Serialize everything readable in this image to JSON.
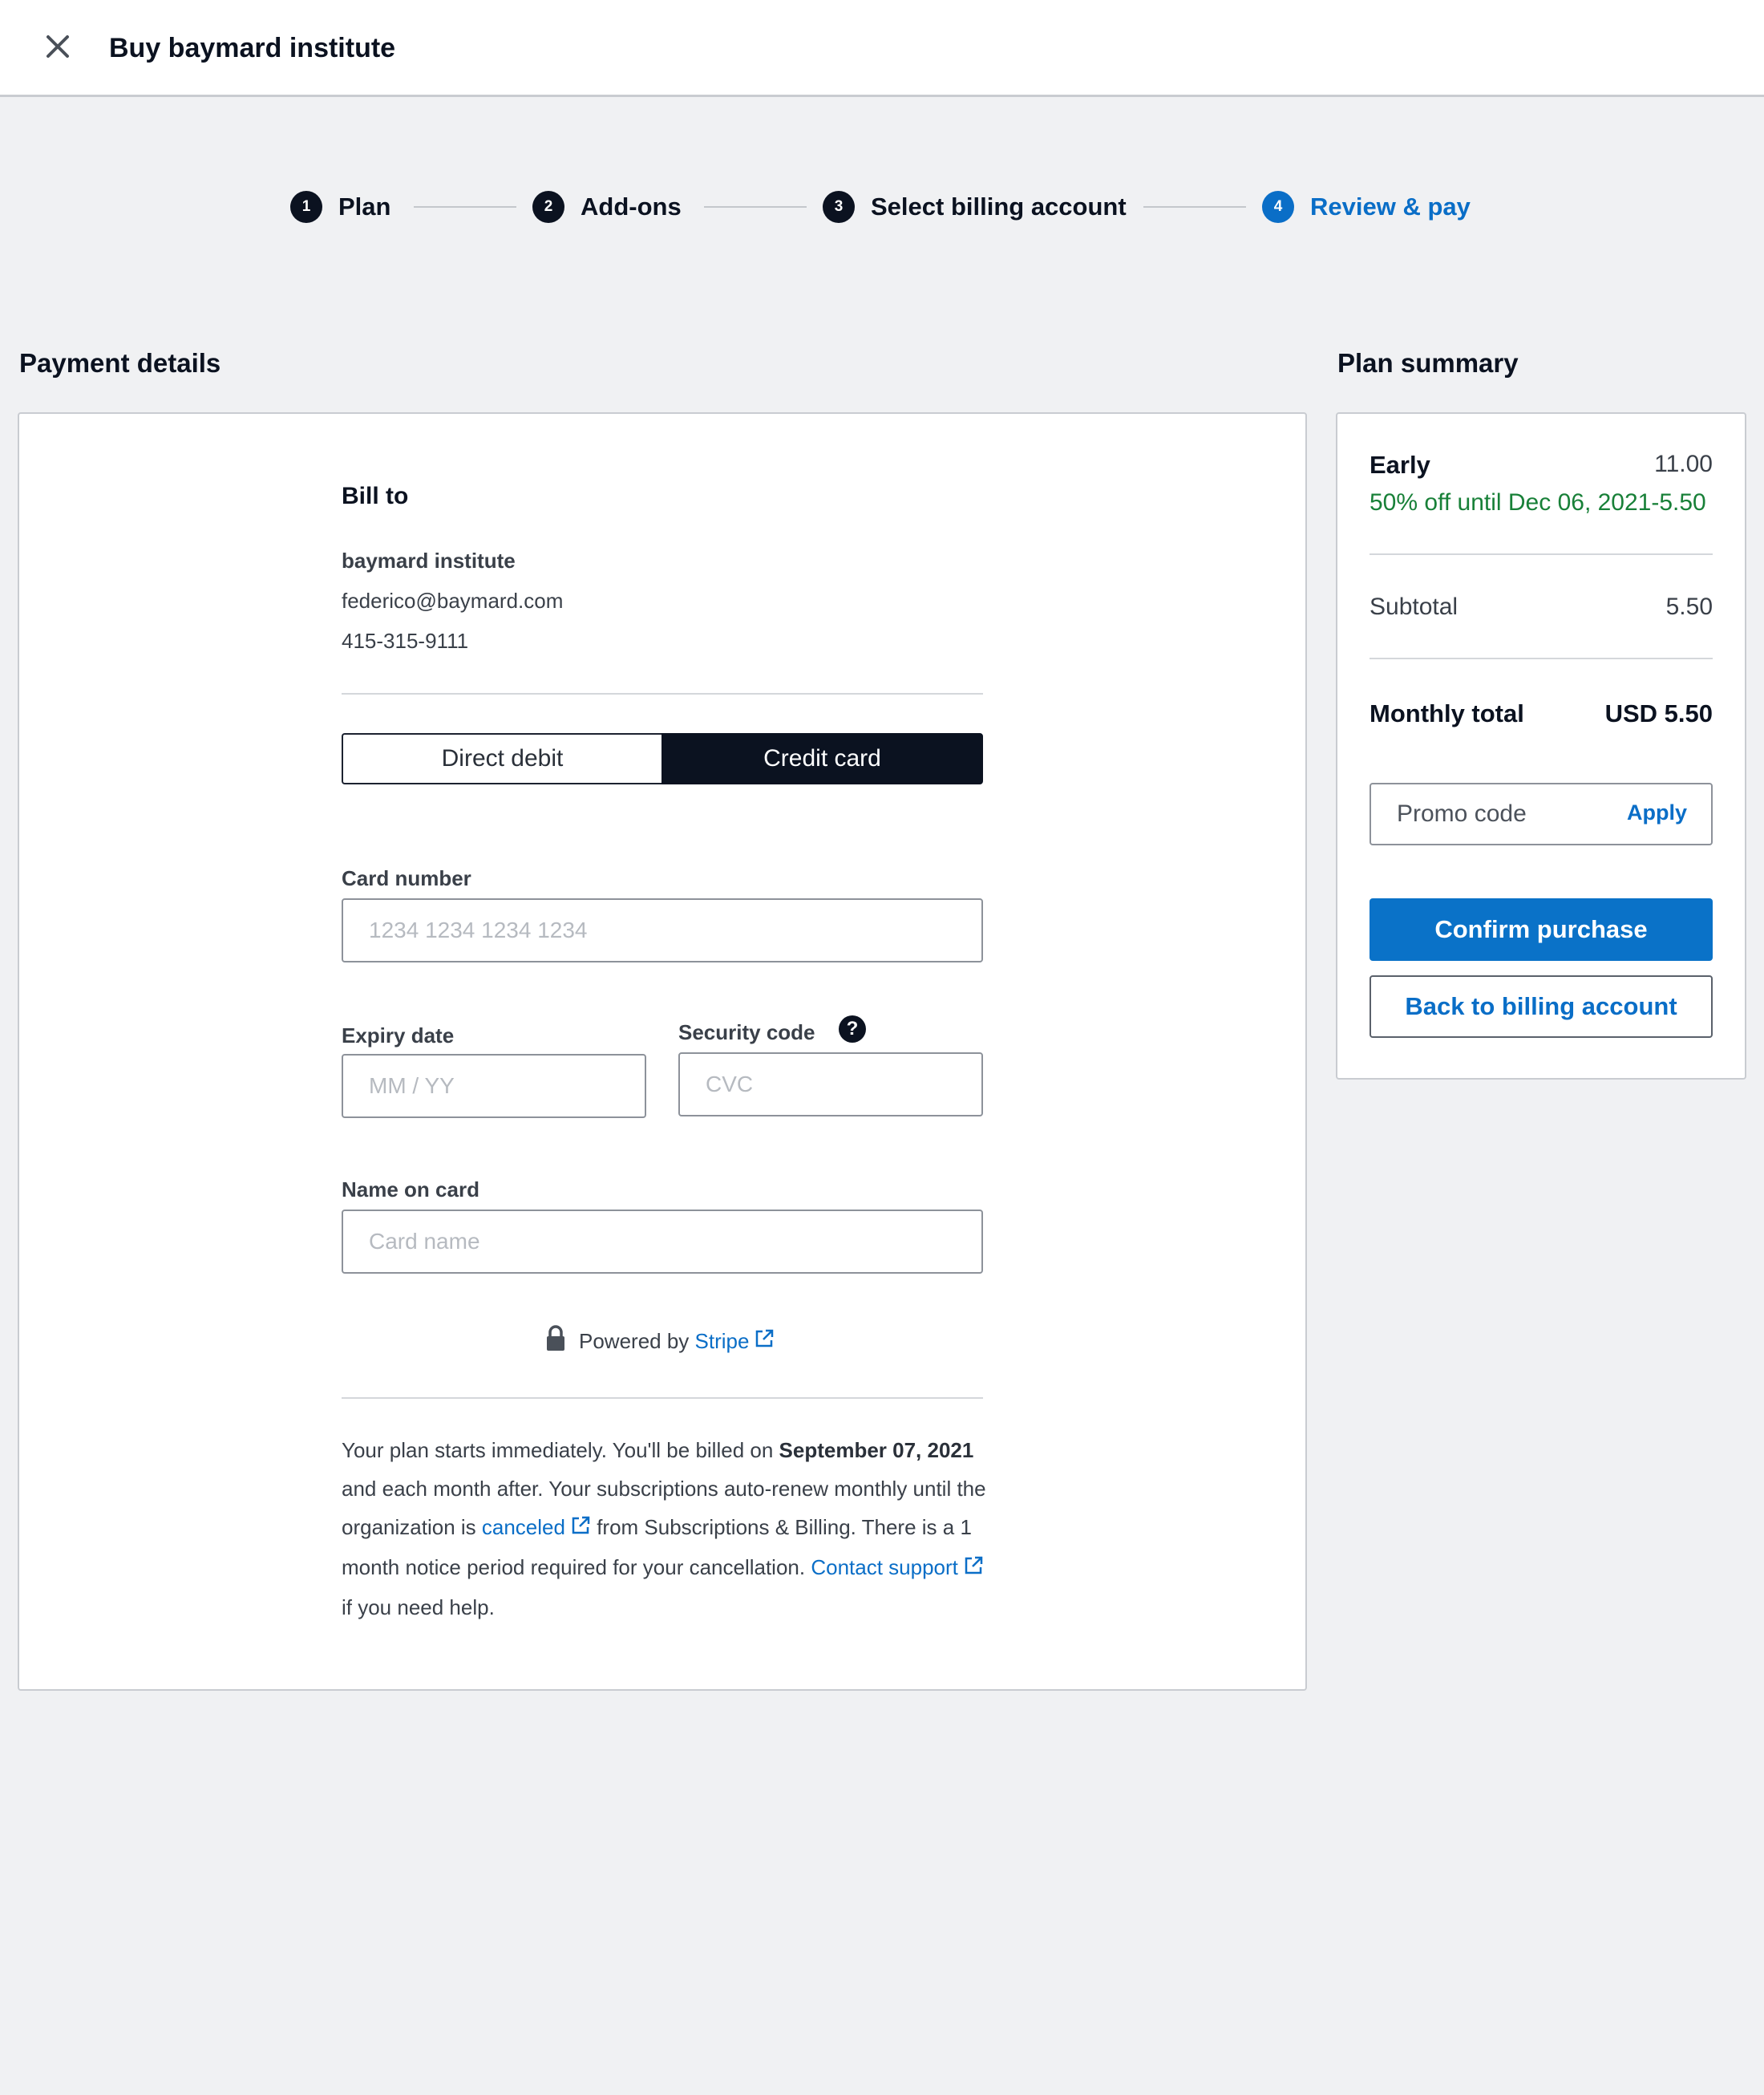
{
  "header": {
    "title": "Buy baymard institute",
    "close_icon": "close-icon"
  },
  "stepper": {
    "steps": [
      {
        "number": "1",
        "label": "Plan",
        "state": "done"
      },
      {
        "number": "2",
        "label": "Add-ons",
        "state": "done"
      },
      {
        "number": "3",
        "label": "Select billing account",
        "state": "done"
      },
      {
        "number": "4",
        "label": "Review & pay",
        "state": "active"
      }
    ],
    "active_color": "#0a6ec7"
  },
  "payment": {
    "section_title": "Payment details",
    "bill_to": {
      "heading": "Bill to",
      "name": "baymard institute",
      "email": "federico@baymard.com",
      "phone": "415-315-9111"
    },
    "method_toggle": {
      "options": [
        "Direct debit",
        "Credit card"
      ],
      "selected": "Credit card"
    },
    "card_number": {
      "label": "Card number",
      "placeholder": "1234 1234 1234 1234"
    },
    "expiry": {
      "label": "Expiry date",
      "placeholder": "MM / YY"
    },
    "security": {
      "label": "Security code",
      "placeholder": "CVC",
      "help_icon": "question-icon"
    },
    "name_on_card": {
      "label": "Name on card",
      "placeholder": "Card name"
    },
    "powered_by": {
      "prefix": "Powered by",
      "link": "Stripe",
      "icon": "lock-icon"
    },
    "legal": {
      "part1": "Your plan starts immediately. You'll be billed on ",
      "date": "September 07, 2021",
      "part2": " and each month after. Your subscriptions auto-renew monthly until the organization is ",
      "canceled_link": "canceled",
      "part3": " from Subscriptions & Billing. There is a 1 month notice period required for your cancellation. ",
      "contact_link": "Contact support",
      "part4": " if you need help."
    }
  },
  "summary": {
    "section_title": "Plan summary",
    "plan_name": "Early",
    "plan_price": "11.00",
    "discount_text": "50% off until Dec 06, 2021",
    "discount_value": "-5.50",
    "discount_color": "#188038",
    "subtotal_label": "Subtotal",
    "subtotal_value": "5.50",
    "total_label": "Monthly total",
    "total_value": "USD 5.50",
    "promo_placeholder": "Promo code",
    "apply_label": "Apply",
    "confirm_label": "Confirm purchase",
    "back_label": "Back to billing account"
  }
}
